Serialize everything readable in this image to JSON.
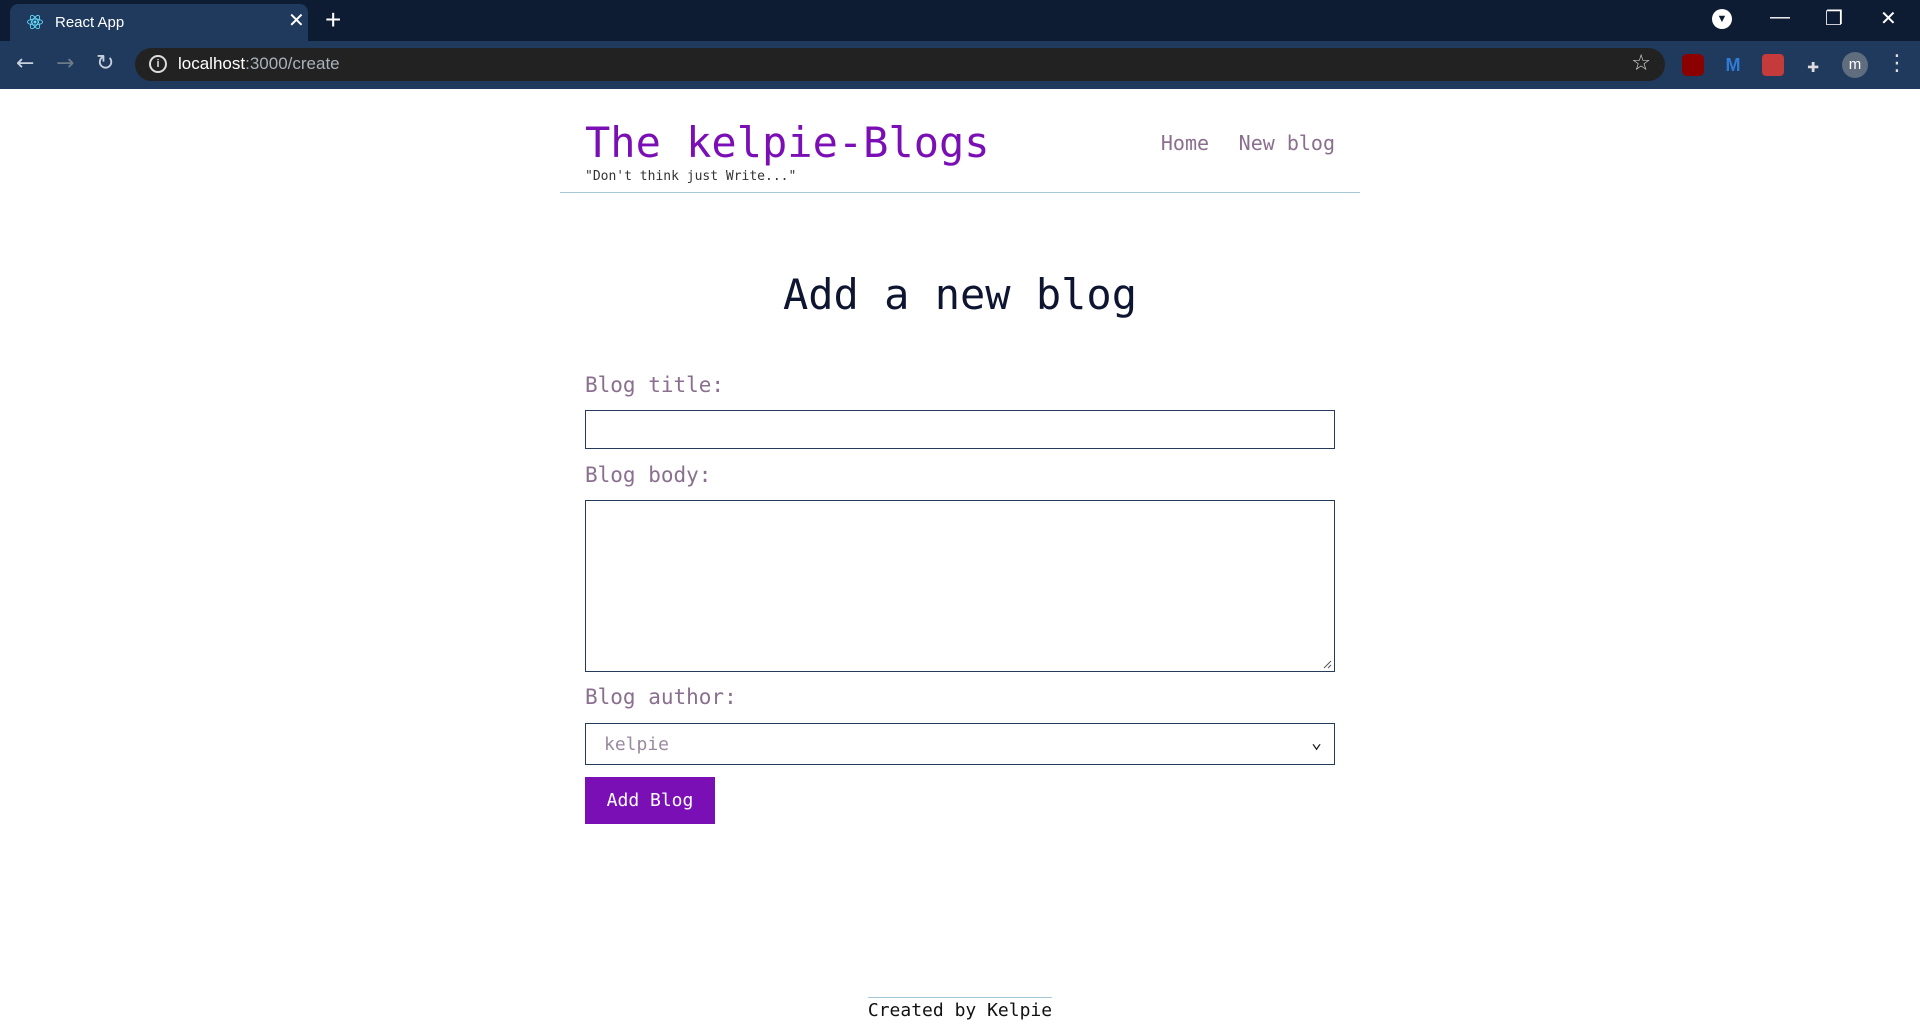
{
  "browser": {
    "tab_title": "React App",
    "url_host": "localhost",
    "url_path": ":3000/create",
    "avatar_letter": "m"
  },
  "site": {
    "brand": "The kelpie-Blogs",
    "tagline": "\"Don't think just Write...\"",
    "nav": [
      "Home",
      "New blog"
    ]
  },
  "form": {
    "heading": "Add a new blog",
    "title_label": "Blog title:",
    "body_label": "Blog body:",
    "author_label": "Blog author:",
    "author_value": "kelpie",
    "submit_label": "Add Blog"
  },
  "footer": {
    "text": "Created by Kelpie"
  },
  "colors": {
    "brand": "#7b0fb6",
    "label": "#8a6f8f"
  }
}
